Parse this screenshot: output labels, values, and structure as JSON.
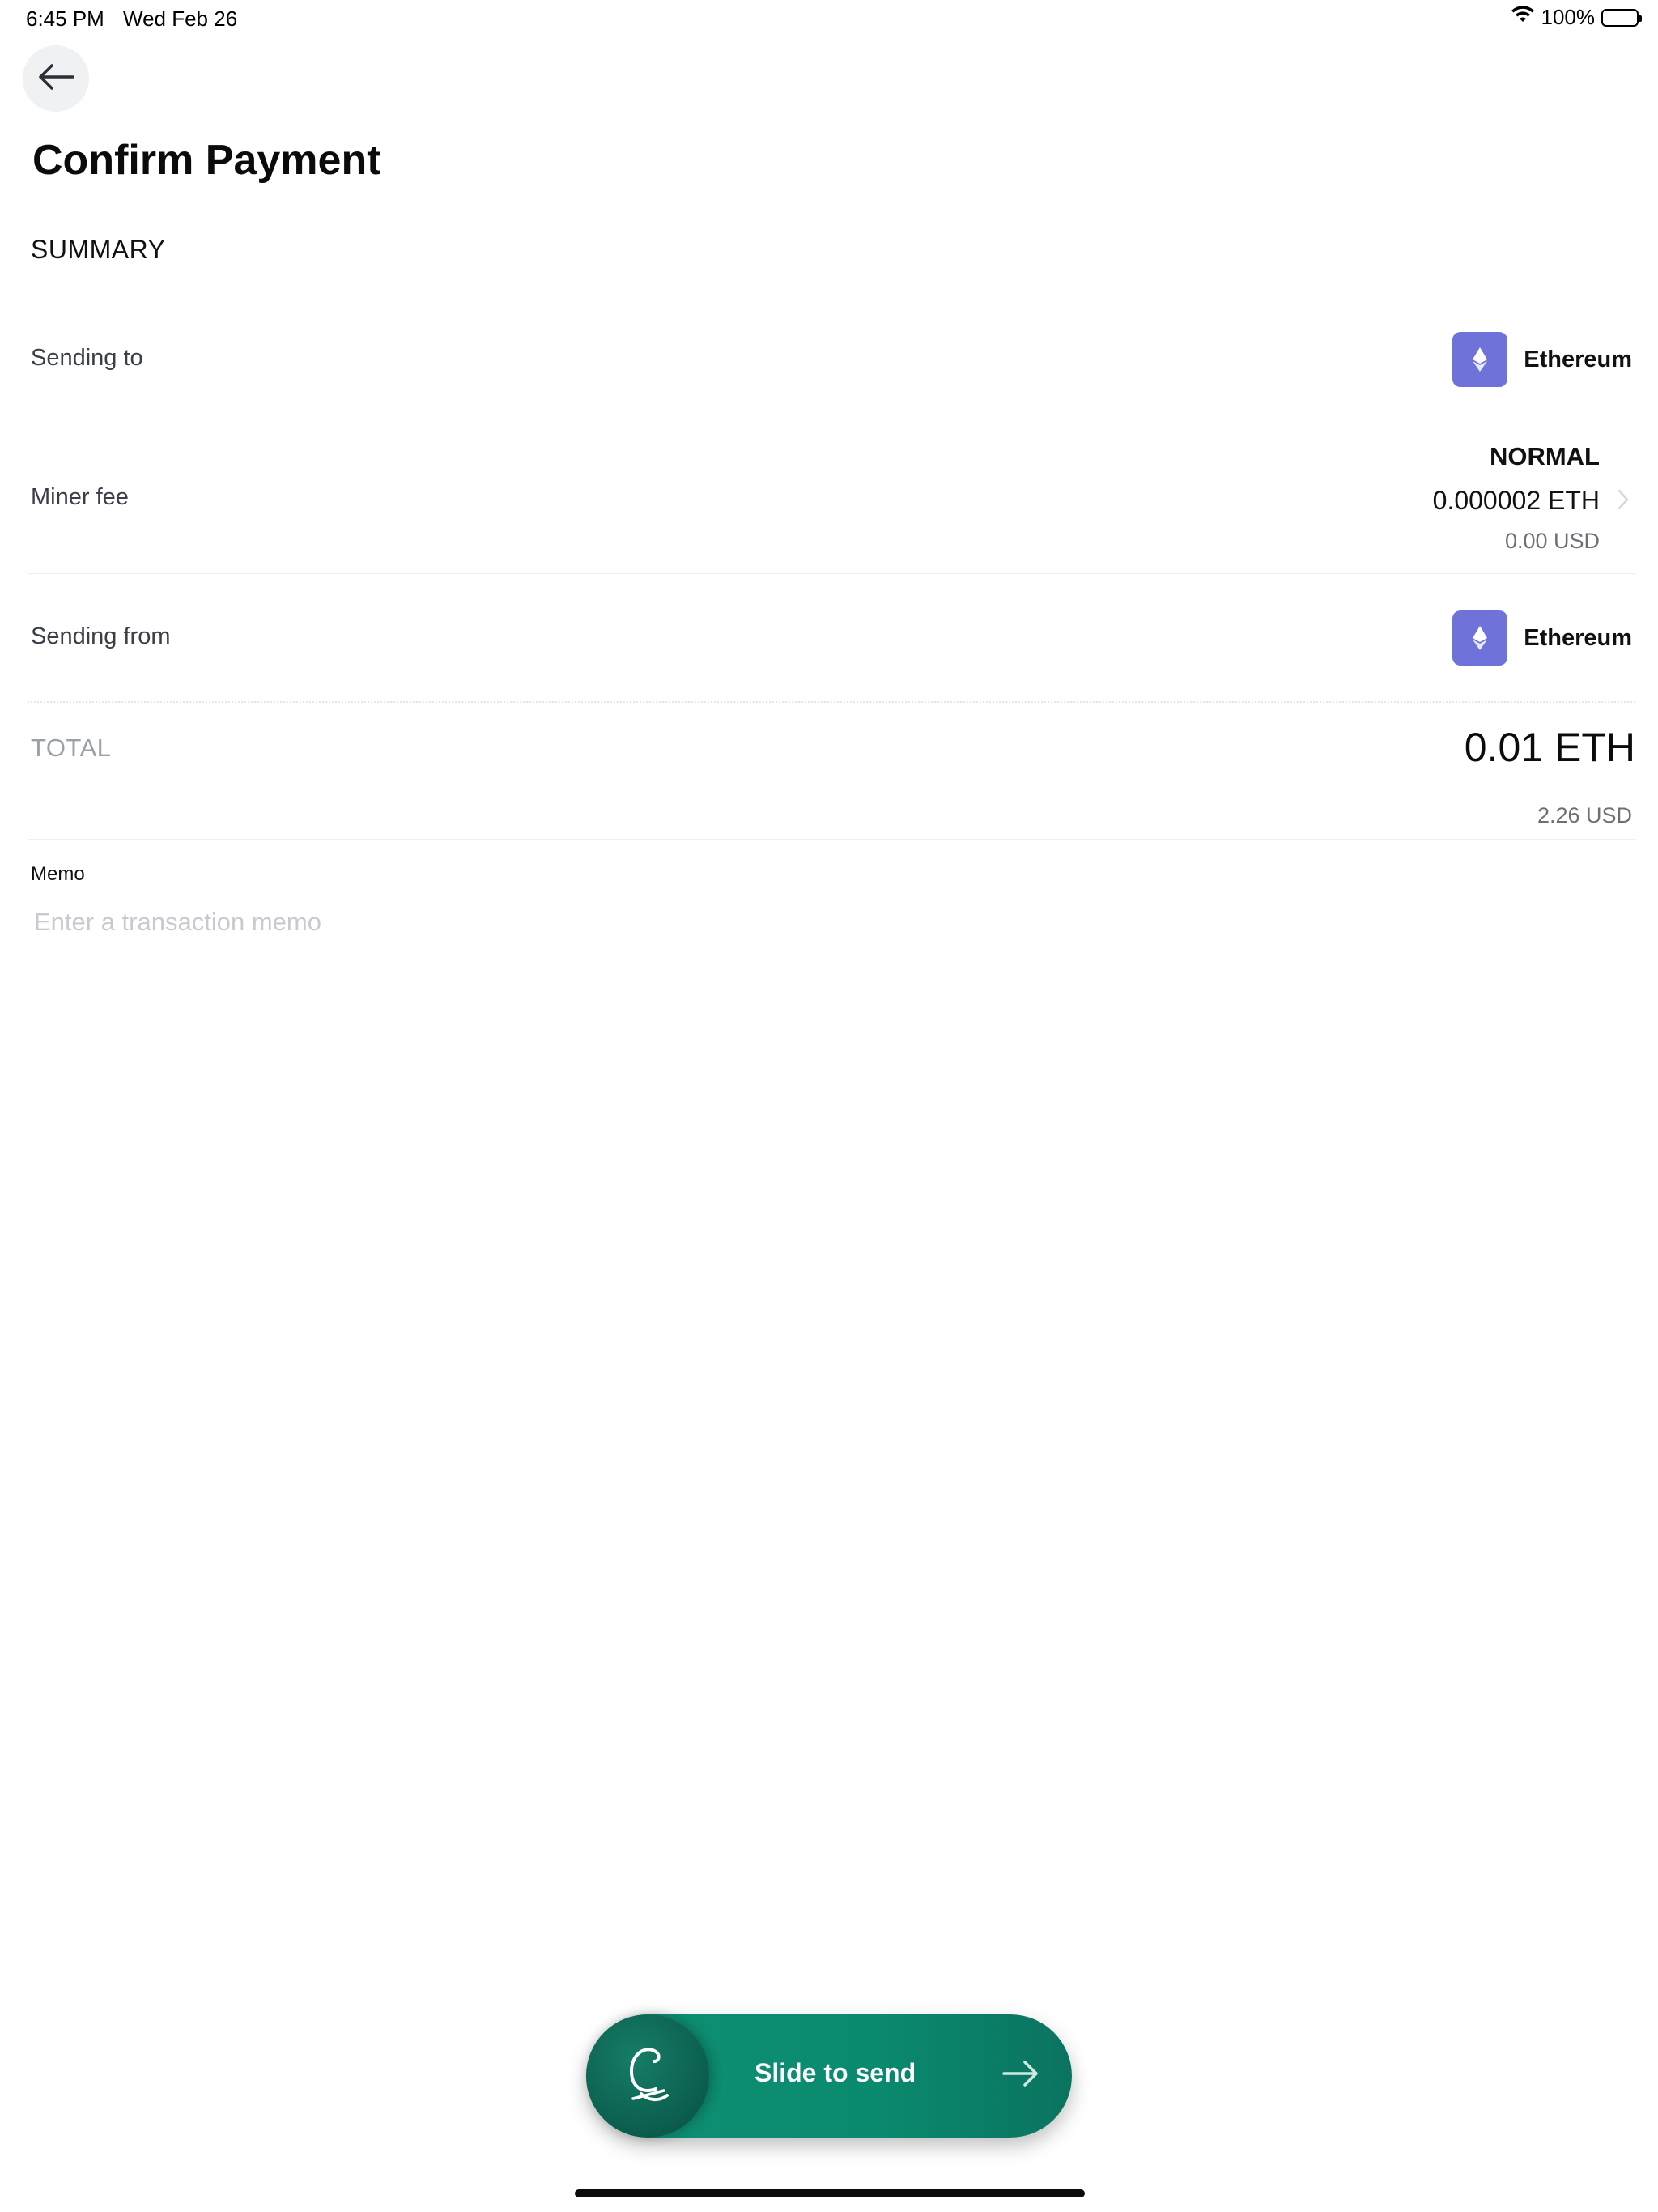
{
  "status_bar": {
    "time": "6:45 PM",
    "date": "Wed Feb 26",
    "battery": "100%"
  },
  "header": {
    "back_icon": "arrow-left-icon",
    "title": "Confirm Payment"
  },
  "summary": {
    "heading": "SUMMARY",
    "sending_to": {
      "label": "Sending to",
      "asset": "Ethereum",
      "icon": "ethereum-icon"
    },
    "miner_fee": {
      "label": "Miner fee",
      "speed": "NORMAL",
      "amount": "0.000002 ETH",
      "usd": "0.00 USD",
      "chevron_icon": "chevron-right-icon"
    },
    "sending_from": {
      "label": "Sending from",
      "asset": "Ethereum",
      "icon": "ethereum-icon"
    },
    "total": {
      "label": "TOTAL",
      "amount": "0.01 ETH",
      "usd": "2.26 USD"
    }
  },
  "memo": {
    "label": "Memo",
    "value": "",
    "placeholder": "Enter a transaction memo"
  },
  "slider": {
    "label": "Slide to send",
    "knob_icon": "coinbase-signature-icon",
    "arrow_icon": "arrow-right-icon"
  },
  "colors": {
    "accent_green": "#0f8f73",
    "ethereum_badge": "#6f72d8",
    "muted_text": "#6b7078"
  }
}
